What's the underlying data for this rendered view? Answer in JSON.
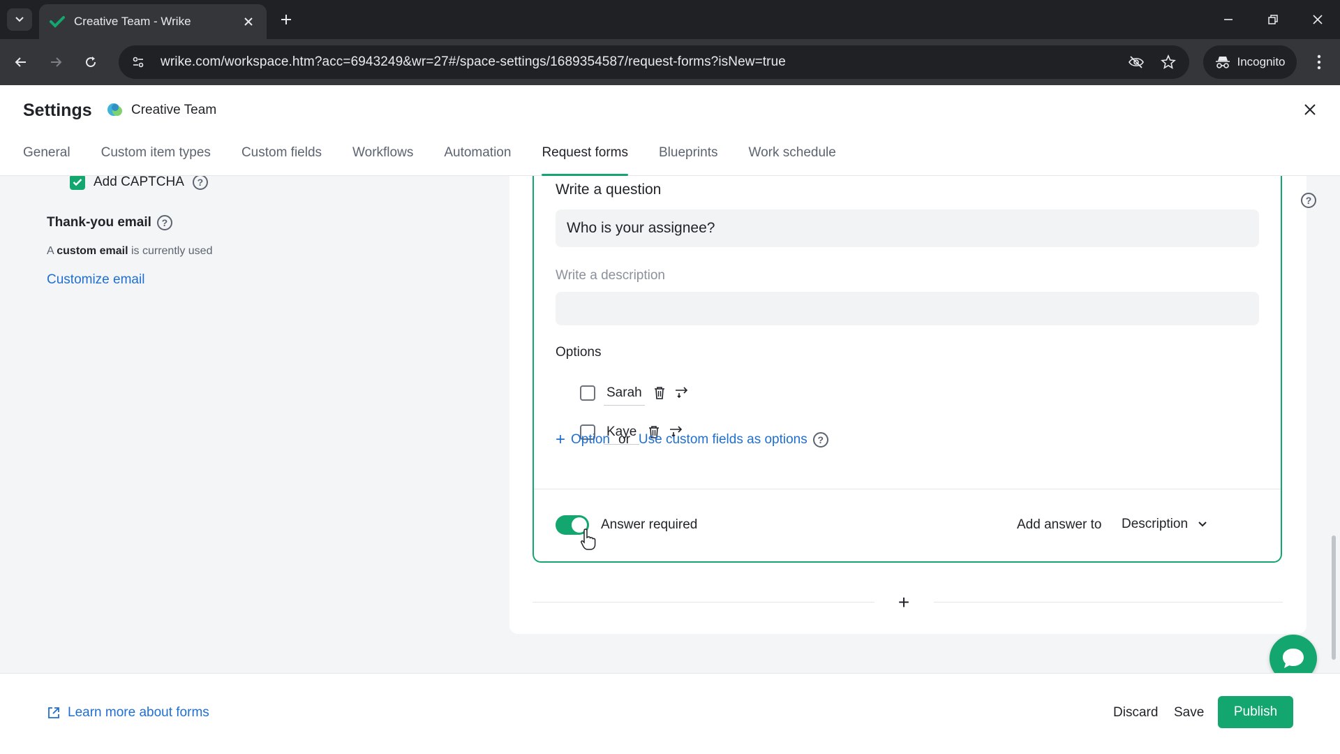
{
  "browser": {
    "tab_title": "Creative Team - Wrike",
    "url": "wrike.com/workspace.htm?acc=6943249&wr=27#/space-settings/1689354587/request-forms?isNew=true",
    "incognito_label": "Incognito"
  },
  "header": {
    "title": "Settings",
    "space_name": "Creative Team",
    "tabs": [
      {
        "label": "General"
      },
      {
        "label": "Custom item types"
      },
      {
        "label": "Custom fields"
      },
      {
        "label": "Workflows"
      },
      {
        "label": "Automation"
      },
      {
        "label": "Request forms",
        "active": true
      },
      {
        "label": "Blueprints"
      },
      {
        "label": "Work schedule"
      }
    ]
  },
  "left_panel": {
    "captcha_label": "Add CAPTCHA",
    "captcha_help": "?",
    "captcha_checked": true,
    "thankyou_title": "Thank-you email",
    "thankyou_help": "?",
    "thankyou_desc_prefix": "A",
    "thankyou_desc_bold": "custom email",
    "thankyou_desc_suffix": "is currently used",
    "customize_link": "Customize email"
  },
  "question": {
    "question_label": "Write a question",
    "question_value": "Who is your assignee?",
    "description_label": "Write a description",
    "description_value": "",
    "options_label": "Options",
    "options": [
      {
        "label": "Sarah",
        "checked": false
      },
      {
        "label": "Kaye",
        "checked": false
      }
    ],
    "add_option": "Option",
    "or_text": "or",
    "custom_fields_link": "Use custom fields as options",
    "custom_fields_help": "?",
    "answer_required_label": "Answer required",
    "answer_required": true,
    "add_answer_label": "Add answer to",
    "add_answer_value": "Description",
    "add_question_symbol": "+"
  },
  "right_help": "?",
  "footer": {
    "learn_more": "Learn more about forms",
    "discard": "Discard",
    "save": "Save",
    "publish": "Publish"
  },
  "colors": {
    "accent": "#13a66f",
    "link": "#1f6fd1",
    "chrome_dark": "#202124",
    "chrome_mid": "#35363a"
  },
  "icons": [
    "tab-list-icon",
    "wrike-check-icon",
    "close-icon",
    "plus-icon",
    "minimize-icon",
    "restore-icon",
    "back-icon",
    "forward-icon",
    "reload-icon",
    "site-info-icon",
    "eye-off-icon",
    "star-icon",
    "incognito-icon",
    "kebab-icon",
    "trash-icon",
    "swap-icon",
    "chevron-down-icon",
    "chat-icon",
    "external-link-icon"
  ]
}
